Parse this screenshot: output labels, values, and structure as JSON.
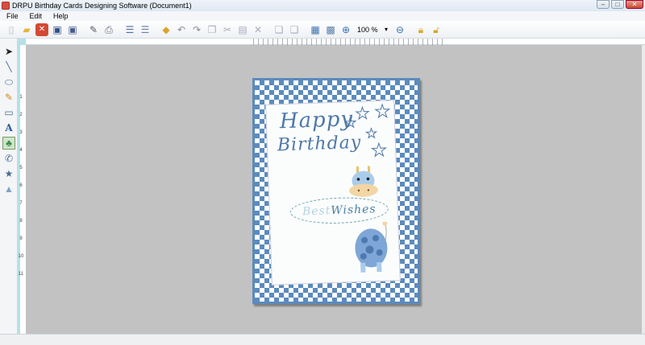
{
  "window": {
    "title": "DRPU Birthday Cards Designing Software  (Document1)"
  },
  "menu": {
    "items": [
      "File",
      "Edit",
      "Help"
    ]
  },
  "toolbar": {
    "zoom_value": "100 %"
  },
  "ruler": {
    "left_numbers": [
      "1",
      "2",
      "3",
      "4",
      "5",
      "6",
      "7",
      "8",
      "9",
      "10",
      "11"
    ]
  },
  "card": {
    "line1": "Happy",
    "line2": "Birthday",
    "wishes_faint": "Best",
    "wishes_main": " Wishes"
  },
  "colors": {
    "card_blue": "#5b8bbd",
    "canvas_gray": "#c2c2c2",
    "ruler_teal": "#b6e0e6"
  }
}
